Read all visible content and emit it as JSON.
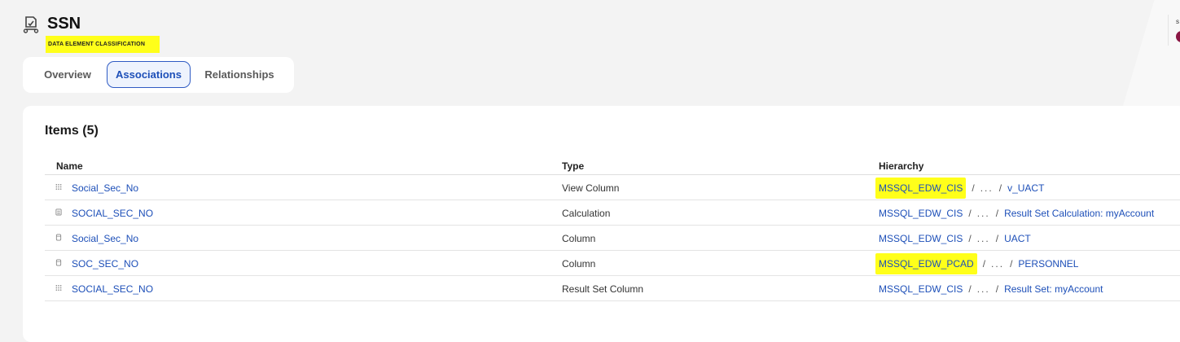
{
  "header": {
    "title": "SSN",
    "subtitle": "DATA ELEMENT CLASSIFICATION",
    "right_label": "s"
  },
  "tabs": [
    {
      "label": "Overview",
      "active": false
    },
    {
      "label": "Associations",
      "active": true
    },
    {
      "label": "Relationships",
      "active": false
    }
  ],
  "items": {
    "title": "Items (5)",
    "columns": [
      "Name",
      "Type",
      "Hierarchy"
    ],
    "rows": [
      {
        "icon": "grid-dots-icon",
        "name": "Social_Sec_No",
        "type": "View Column",
        "root": "MSSQL_EDW_CIS",
        "root_highlighted": true,
        "ellipsis": "...",
        "leaf": "v_UACT"
      },
      {
        "icon": "calculator-icon",
        "name": "SOCIAL_SEC_NO",
        "type": "Calculation",
        "root": "MSSQL_EDW_CIS",
        "root_highlighted": false,
        "ellipsis": "...",
        "leaf": "Result Set Calculation: myAccount"
      },
      {
        "icon": "column-icon",
        "name": "Social_Sec_No",
        "type": "Column",
        "root": "MSSQL_EDW_CIS",
        "root_highlighted": false,
        "ellipsis": "...",
        "leaf": "UACT"
      },
      {
        "icon": "column-icon",
        "name": "SOC_SEC_NO",
        "type": "Column",
        "root": "MSSQL_EDW_PCAD",
        "root_highlighted": true,
        "ellipsis": "...",
        "leaf": "PERSONNEL"
      },
      {
        "icon": "grid-dots-icon",
        "name": "SOCIAL_SEC_NO",
        "type": "Result Set Column",
        "root": "MSSQL_EDW_CIS",
        "root_highlighted": false,
        "ellipsis": "...",
        "leaf": "Result Set: myAccount"
      }
    ]
  },
  "colors": {
    "link": "#1d4fb8",
    "highlight": "#ffff1a",
    "active_tab_border": "#2f5bc4",
    "avatar": "#8a1744"
  }
}
